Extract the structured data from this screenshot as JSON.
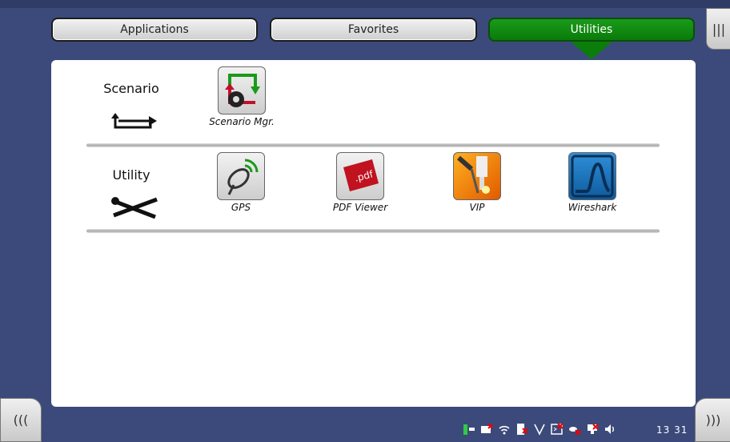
{
  "tabs": {
    "applications": "Applications",
    "favorites": "Favorites",
    "utilities": "Utilities",
    "active": "Utilities"
  },
  "side": {
    "menu_glyph": "|||",
    "left_glyph": "(((",
    "right_glyph": ")))"
  },
  "categories": {
    "scenario": {
      "label": "Scenario",
      "icon": "scenario-loop-icon",
      "apps": [
        {
          "label": "Scenario Mgr.",
          "icon": "scenario-manager-icon"
        }
      ]
    },
    "utility": {
      "label": "Utility",
      "icon": "tools-wrench-screwdriver-icon",
      "apps": [
        {
          "label": "GPS",
          "icon": "gps-satellite-icon"
        },
        {
          "label": "PDF Viewer",
          "icon": "pdf-icon"
        },
        {
          "label": "VIP",
          "icon": "vip-probe-icon"
        },
        {
          "label": "Wireshark",
          "icon": "wireshark-fin-icon"
        }
      ]
    }
  },
  "status": {
    "icons": [
      "power-plug-icon",
      "camera-off-icon",
      "wifi-icon",
      "bluetooth-off-icon",
      "v-icon",
      "terminal-off-icon",
      "satellite-off-icon",
      "network-off-icon",
      "speaker-icon"
    ],
    "time_h": "13",
    "time_m": "31"
  },
  "colors": {
    "frame": "#3b4a7a",
    "active_tab": "#0a8a0a",
    "panel": "#ffffff"
  }
}
